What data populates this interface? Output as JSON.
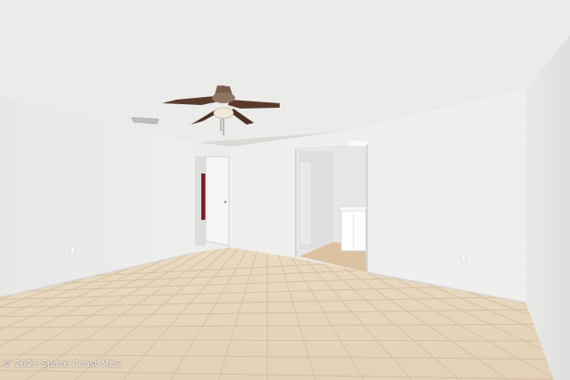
{
  "photo": {
    "subject": "empty-room-interior",
    "watermark_text": "© 2025 Space Coast MLS"
  },
  "colors": {
    "ceiling": "#ececea",
    "wall_left": "#e8e8e6",
    "wall_back": "#efefed",
    "wall_right": "#e2e2e0",
    "floor_tile": "#e6d6bf",
    "grout": "#c9b79d",
    "fan_blade": "#5b3a2e",
    "door": "#f4f4f2",
    "cabinet": "#ffffff"
  },
  "icons": [
    "ceiling-fan-icon",
    "air-vent-icon",
    "outlet-icon",
    "light-fixture-icon"
  ]
}
